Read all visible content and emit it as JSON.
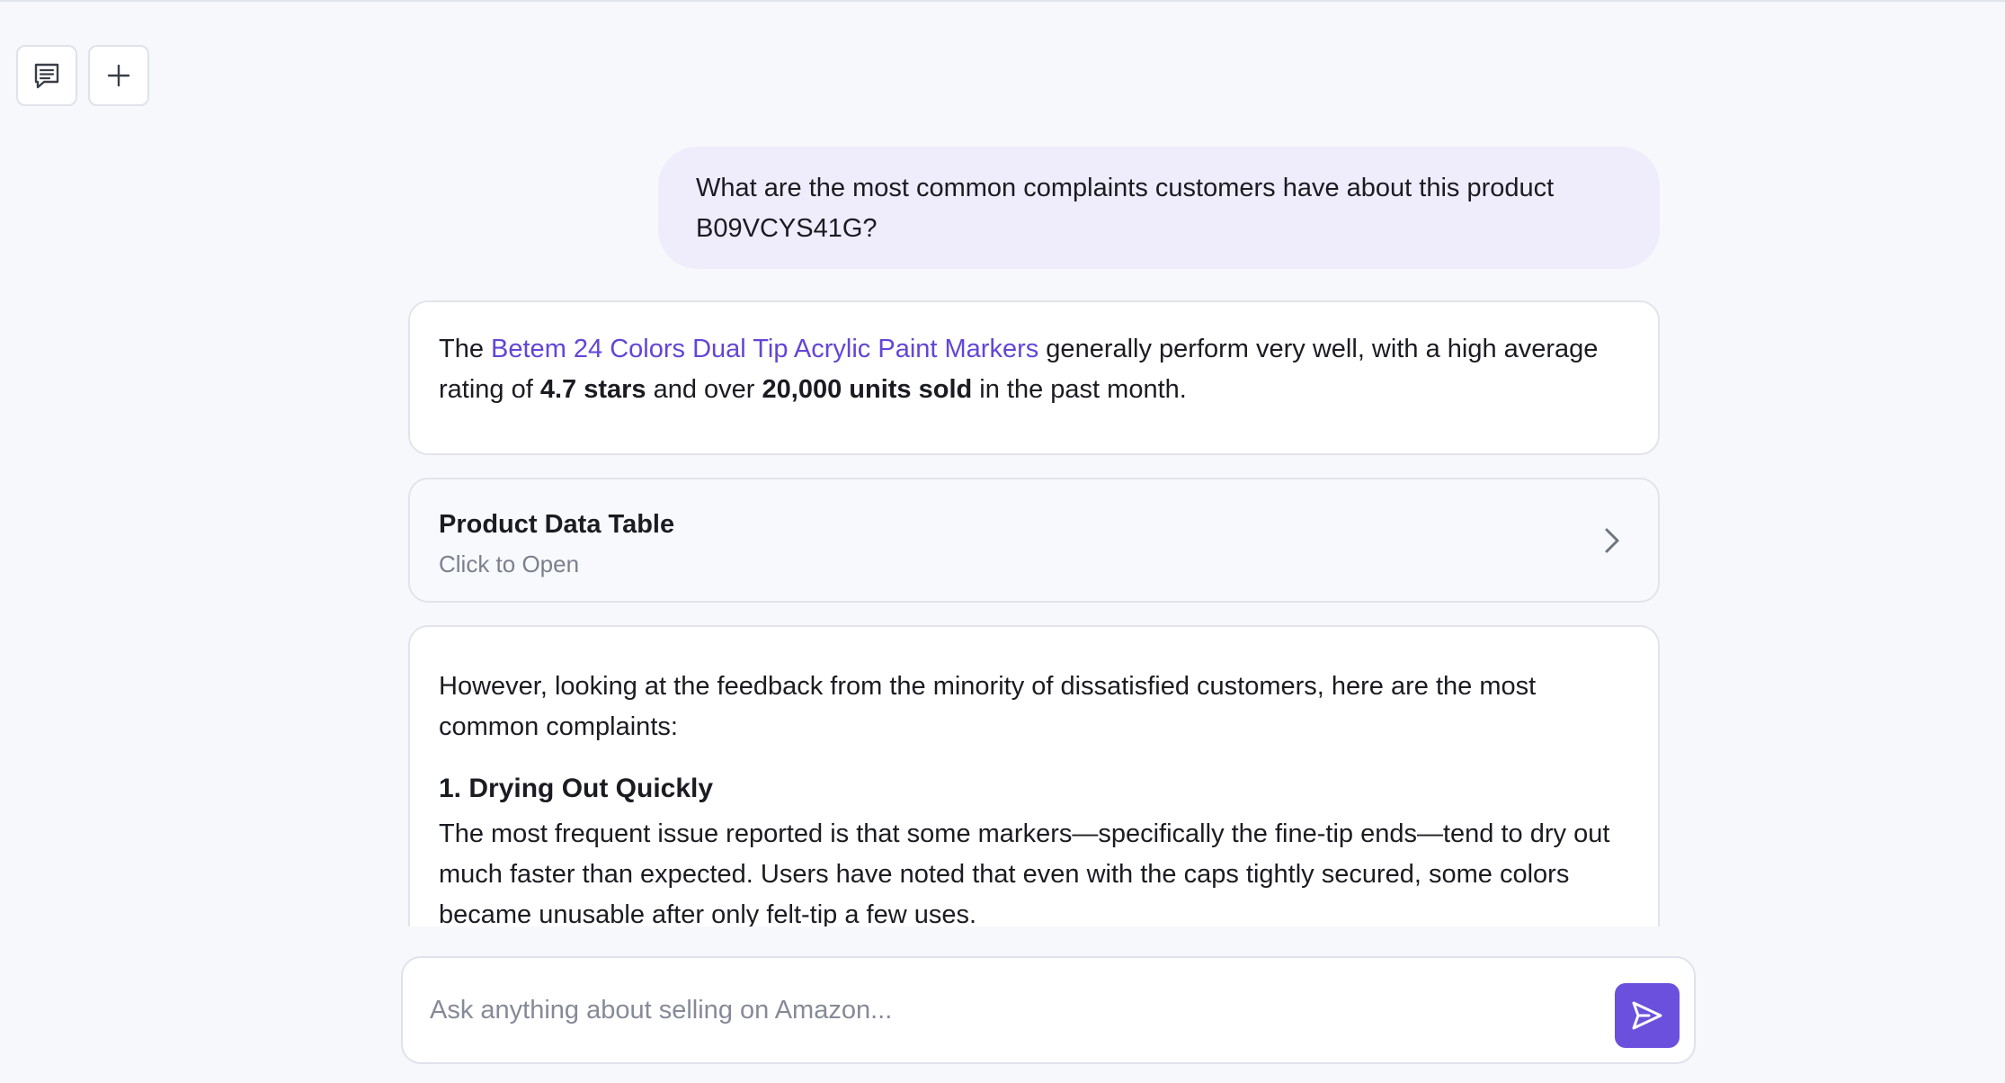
{
  "toolbar": {
    "history_icon": "chat-history-icon",
    "new_chat_icon": "plus-icon"
  },
  "conversation": {
    "user_message": "What are the most common complaints customers have about this product B09VCYS41G?",
    "summary": {
      "prefix": "The ",
      "product_link": "Betem 24 Colors Dual Tip Acrylic Paint Markers",
      "middle": " generally perform very well, with a high average rating of ",
      "rating": "4.7 stars",
      "connector": " and over ",
      "units": "20,000 units sold",
      "suffix": " in the past month."
    },
    "data_table_card": {
      "title": "Product Data Table",
      "subtitle": "Click to Open",
      "icon": "chevron-right-icon"
    },
    "complaints": {
      "intro": "However, looking at the feedback from the minority of dissatisfied customers, here are the most common complaints:",
      "items": [
        {
          "heading": "1. Drying Out Quickly",
          "body": "The most frequent issue reported is that some markers—specifically the fine-tip ends—tend to dry out much faster than expected. Users have noted that even with the caps tightly secured, some colors became unusable after only felt-tip a few uses."
        }
      ]
    }
  },
  "composer": {
    "placeholder": "Ask anything about selling on Amazon...",
    "value": "",
    "send_icon": "send-icon"
  },
  "colors": {
    "accent": "#6a50dc",
    "link": "#6246d6",
    "user_bubble": "#efecfb",
    "background": "#f7f8fc"
  }
}
